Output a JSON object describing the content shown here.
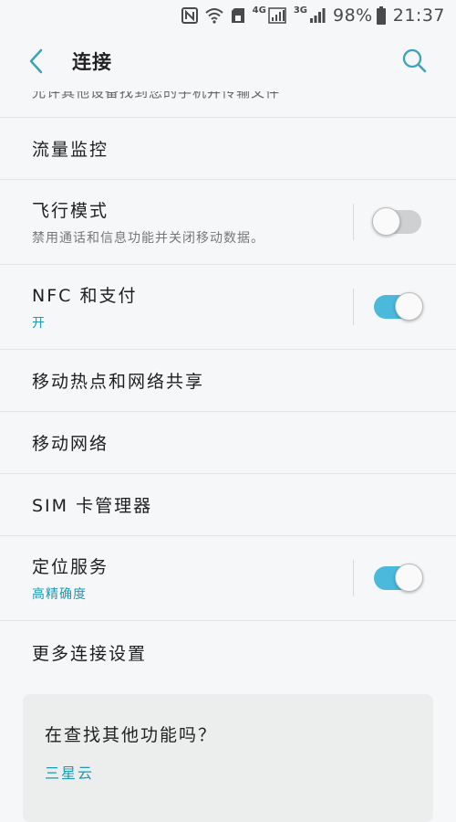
{
  "status_bar": {
    "network_4g": "4G",
    "network_3g": "3G",
    "battery_percent": "98%",
    "time": "21:37"
  },
  "header": {
    "title": "连接"
  },
  "list": {
    "partial_text": "允许其他设备找到您的手机并传输文件",
    "items": [
      {
        "title": "流量监控"
      },
      {
        "title": "飞行模式",
        "subtitle": "禁用通话和信息功能并关闭移动数据。",
        "toggle": "off"
      },
      {
        "title": "NFC 和支付",
        "subtitle": "开",
        "toggle": "on"
      },
      {
        "title": "移动热点和网络共享"
      },
      {
        "title": "移动网络"
      },
      {
        "title": "SIM 卡管理器"
      },
      {
        "title": "定位服务",
        "subtitle": "高精确度",
        "toggle": "on"
      },
      {
        "title": "更多连接设置"
      }
    ]
  },
  "card": {
    "title": "在查找其他功能吗？",
    "link": "三星云"
  },
  "colors": {
    "accent": "#4ab9dc",
    "link": "#1a9bb5",
    "background": "#f6f7f9"
  }
}
